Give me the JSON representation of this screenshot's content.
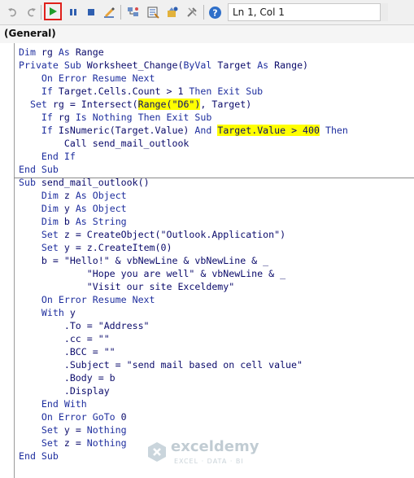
{
  "toolbar": {
    "buttons": [
      {
        "name": "undo-button",
        "icon": "undo-icon"
      },
      {
        "name": "redo-button",
        "icon": "redo-icon"
      },
      {
        "name": "run-button",
        "icon": "play-icon"
      },
      {
        "name": "break-button",
        "icon": "pause-icon"
      },
      {
        "name": "reset-button",
        "icon": "stop-icon"
      },
      {
        "name": "design-mode-button",
        "icon": "design-icon"
      },
      {
        "name": "project-explorer-button",
        "icon": "project-icon"
      },
      {
        "name": "properties-button",
        "icon": "properties-icon"
      },
      {
        "name": "object-browser-button",
        "icon": "object-browser-icon"
      },
      {
        "name": "toolbox-button",
        "icon": "toolbox-icon"
      },
      {
        "name": "help-button",
        "icon": "help-icon"
      }
    ],
    "position_label": "Ln 1, Col 1"
  },
  "object_dropdown": {
    "selected": "(General)"
  },
  "code_lines": [
    [
      {
        "t": "Dim",
        "k": 1
      },
      {
        "t": " rg "
      },
      {
        "t": "As",
        "k": 1
      },
      {
        "t": " Range"
      }
    ],
    [
      {
        "t": "Private",
        "k": 1
      },
      {
        "t": " "
      },
      {
        "t": "Sub",
        "k": 1
      },
      {
        "t": " Worksheet_Change("
      },
      {
        "t": "ByVal",
        "k": 1
      },
      {
        "t": " Target "
      },
      {
        "t": "As",
        "k": 1
      },
      {
        "t": " Range)"
      }
    ],
    [
      {
        "t": "    "
      },
      {
        "t": "On Error Resume Next",
        "k": 1
      }
    ],
    [
      {
        "t": "    "
      },
      {
        "t": "If",
        "k": 1
      },
      {
        "t": " Target.Cells.Count > 1 "
      },
      {
        "t": "Then Exit Sub",
        "k": 1
      }
    ],
    [
      {
        "t": "  "
      },
      {
        "t": "Set",
        "k": 1
      },
      {
        "t": " rg = Intersect("
      },
      {
        "t": "Range(\"D6\")",
        "h": 1
      },
      {
        "t": ", Target)"
      }
    ],
    [
      {
        "t": "    "
      },
      {
        "t": "If",
        "k": 1
      },
      {
        "t": " rg "
      },
      {
        "t": "Is Nothing Then Exit Sub",
        "k": 1
      }
    ],
    [
      {
        "t": "    "
      },
      {
        "t": "If",
        "k": 1
      },
      {
        "t": " IsNumeric(Target.Value) "
      },
      {
        "t": "And",
        "k": 1
      },
      {
        "t": " "
      },
      {
        "t": "Target.Value > 400",
        "h": 1
      },
      {
        "t": " "
      },
      {
        "t": "Then",
        "k": 1
      }
    ],
    [
      {
        "t": "        Call send_mail_outlook"
      }
    ],
    [
      {
        "t": "    "
      },
      {
        "t": "End If",
        "k": 1
      }
    ],
    [
      {
        "t": "End Sub",
        "k": 1
      }
    ],
    [
      {
        "t": "Sub",
        "k": 1
      },
      {
        "t": " send_mail_outlook()"
      }
    ],
    [
      {
        "t": "    "
      },
      {
        "t": "Dim",
        "k": 1
      },
      {
        "t": " z "
      },
      {
        "t": "As Object",
        "k": 1
      }
    ],
    [
      {
        "t": "    "
      },
      {
        "t": "Dim",
        "k": 1
      },
      {
        "t": " y "
      },
      {
        "t": "As Object",
        "k": 1
      }
    ],
    [
      {
        "t": "    "
      },
      {
        "t": "Dim",
        "k": 1
      },
      {
        "t": " b "
      },
      {
        "t": "As String",
        "k": 1
      }
    ],
    [
      {
        "t": "    "
      },
      {
        "t": "Set",
        "k": 1
      },
      {
        "t": " z = CreateObject(\"Outlook.Application\")"
      }
    ],
    [
      {
        "t": "    "
      },
      {
        "t": "Set",
        "k": 1
      },
      {
        "t": " y = z.CreateItem(0)"
      }
    ],
    [
      {
        "t": "    b = \"Hello!\" & vbNewLine & vbNewLine & _"
      }
    ],
    [
      {
        "t": "            \"Hope you are well\" & vbNewLine & _"
      }
    ],
    [
      {
        "t": "            \"Visit our site Exceldemy\""
      }
    ],
    [
      {
        "t": "    "
      },
      {
        "t": "On Error Resume Next",
        "k": 1
      }
    ],
    [
      {
        "t": "    "
      },
      {
        "t": "With",
        "k": 1
      },
      {
        "t": " y"
      }
    ],
    [
      {
        "t": "        .To = \"Address\""
      }
    ],
    [
      {
        "t": "        .cc = \"\""
      }
    ],
    [
      {
        "t": "        .BCC = \"\""
      }
    ],
    [
      {
        "t": "        .Subject = \"send mail based on cell value\""
      }
    ],
    [
      {
        "t": "        .Body = b"
      }
    ],
    [
      {
        "t": "        .Display"
      }
    ],
    [
      {
        "t": "    "
      },
      {
        "t": "End With",
        "k": 1
      }
    ],
    [
      {
        "t": "    "
      },
      {
        "t": "On Error GoTo",
        "k": 1
      },
      {
        "t": " 0"
      }
    ],
    [
      {
        "t": "    "
      },
      {
        "t": "Set",
        "k": 1
      },
      {
        "t": " y = "
      },
      {
        "t": "Nothing",
        "k": 1
      }
    ],
    [
      {
        "t": "    "
      },
      {
        "t": "Set",
        "k": 1
      },
      {
        "t": " z = "
      },
      {
        "t": "Nothing",
        "k": 1
      }
    ],
    [
      {
        "t": "End Sub",
        "k": 1
      }
    ]
  ],
  "watermark": {
    "name": "exceldemy",
    "tagline": "EXCEL · DATA · BI"
  },
  "colors": {
    "keyword": "#1e2e9e",
    "text": "#0b0b6b",
    "highlight": "#ffff00",
    "run_box": "#e0201b"
  }
}
